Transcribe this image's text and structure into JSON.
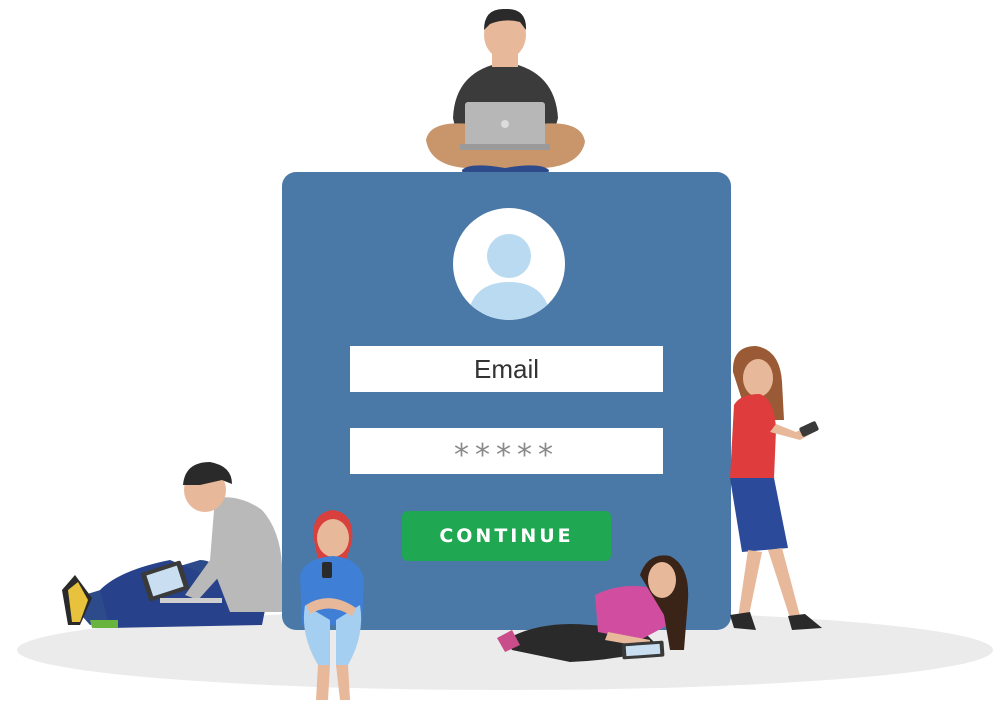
{
  "login_form": {
    "email_label": "Email",
    "password_mask": "*****",
    "continue_label": "CONTINUE"
  },
  "colors": {
    "panel": "#4b79a7",
    "continue_button": "#1fa851",
    "avatar_silhouette": "#b9daf1"
  },
  "icons": {
    "avatar": "user-avatar-icon"
  },
  "illustration": {
    "figures": [
      "person-on-laptop-top",
      "person-with-laptop-sitting",
      "person-with-phone-sitting",
      "person-lying-with-tablet",
      "person-standing-with-phone"
    ]
  }
}
